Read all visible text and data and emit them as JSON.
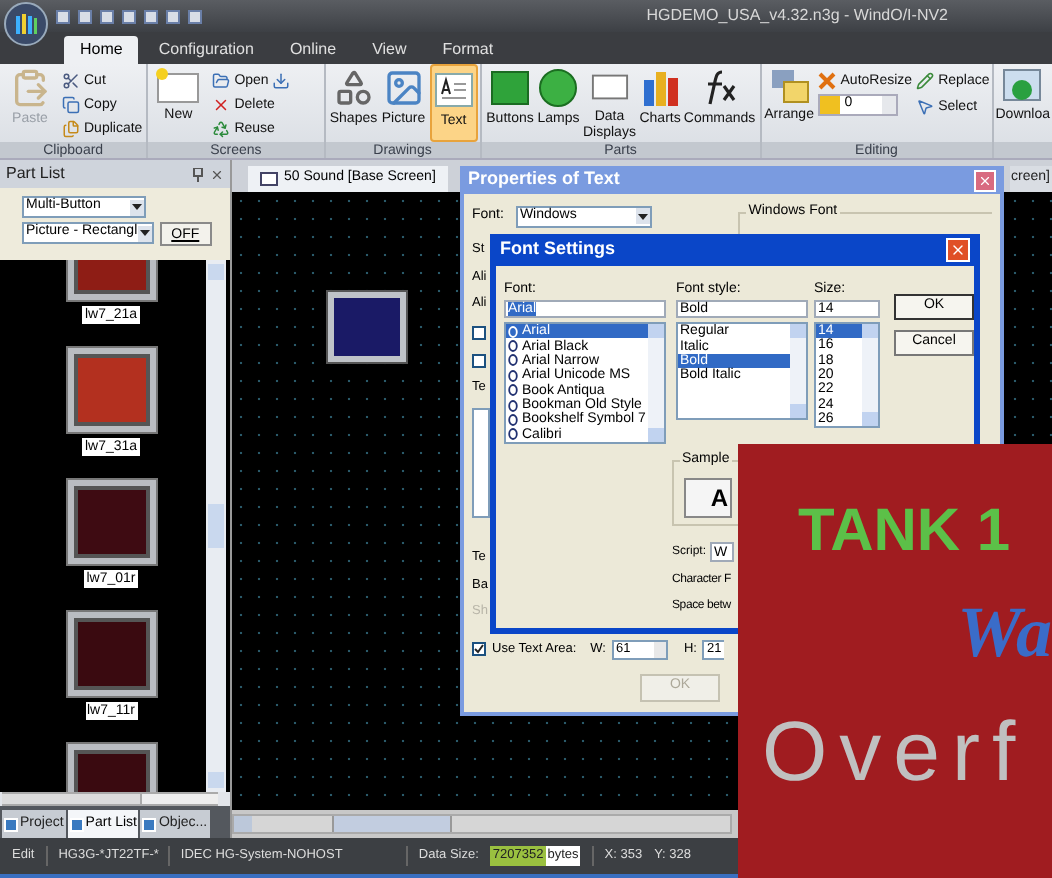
{
  "window": {
    "title": "HGDEMO_USA_v4.32.n3g - WindO/I-NV2"
  },
  "ribbon_tabs": [
    {
      "label": "Home",
      "selected": true
    },
    {
      "label": "Configuration",
      "selected": false
    },
    {
      "label": "Online",
      "selected": false
    },
    {
      "label": "View",
      "selected": false
    },
    {
      "label": "Format",
      "selected": false
    }
  ],
  "ribbon": {
    "clipboard": {
      "label": "Clipboard",
      "items": [
        {
          "label": "Paste",
          "disabled": true
        },
        {
          "label": "Cut",
          "disabled": false
        },
        {
          "label": "Copy",
          "disabled": false
        },
        {
          "label": "Duplicate",
          "disabled": false
        }
      ]
    },
    "screens": {
      "label": "Screens",
      "new": "New",
      "open": "Open",
      "delete": "Delete",
      "reuse": "Reuse"
    },
    "drawings": {
      "label": "Drawings",
      "items": [
        {
          "label": "Shapes",
          "selected": false
        },
        {
          "label": "Picture",
          "selected": false
        },
        {
          "label": "Text",
          "selected": true
        }
      ]
    },
    "parts": {
      "label": "Parts",
      "items": [
        "Buttons",
        "Lamps",
        "Data Displays",
        "Charts",
        "Commands"
      ]
    },
    "editing": {
      "label": "Editing",
      "arrange": "Arrange",
      "autoresize": "AutoResize",
      "spin_value": "0",
      "replace": "Replace",
      "select": "Select"
    },
    "download": {
      "label": "Downloa"
    }
  },
  "part_list": {
    "title": "Part List",
    "type_select": "Multi-Button",
    "style_select": "Picture - Rectangl",
    "state_button": "OFF",
    "parts": [
      {
        "label": "lw7_21a",
        "color": "#8e1d15"
      },
      {
        "label": "lw7_31a",
        "color": "#b3301f"
      },
      {
        "label": "lw7_01r",
        "color": "#3e0b12"
      },
      {
        "label": "lw7_11r",
        "color": "#3a0a10"
      },
      {
        "color": "#3a0a10"
      }
    ],
    "bottom_tabs": [
      {
        "label": "Project",
        "selected": false
      },
      {
        "label": "Part List",
        "selected": true
      },
      {
        "label": "Objec...",
        "selected": false
      }
    ]
  },
  "editor": {
    "tabs": [
      {
        "label": "50 Sound [Base Screen]",
        "selected": true
      },
      {
        "label": "creen]",
        "selected": false
      }
    ]
  },
  "properties_dialog": {
    "title": "Properties of Text",
    "font_label": "Font:",
    "font_value": "Windows",
    "windows_font_group": "Windows Font",
    "side_labels": [
      "St",
      "Ali",
      "Ali"
    ],
    "checkboxes": [
      {
        "checked": false
      },
      {
        "checked": false
      }
    ],
    "lower_labels": [
      {
        "label": "Te",
        "disabled": false
      },
      {
        "label": "Ba",
        "disabled": false
      },
      {
        "label": "Sh",
        "disabled": true
      }
    ],
    "text_area_label": "Te",
    "use_text_area": {
      "label": "Use Text Area:",
      "checked": true
    },
    "w_label": "W:",
    "w_value": "61",
    "h_label": "H:",
    "h_value": "21",
    "ok": {
      "label": "OK",
      "disabled": true
    }
  },
  "font_dialog": {
    "title": "Font Settings",
    "font_label": "Font:",
    "font_value": "Arial",
    "fonts": [
      {
        "label": "Arial",
        "selected": true
      },
      {
        "label": "Arial Black",
        "selected": false
      },
      {
        "label": "Arial Narrow",
        "selected": false
      },
      {
        "label": "Arial Unicode MS",
        "selected": false
      },
      {
        "label": "Book Antiqua",
        "selected": false
      },
      {
        "label": "Bookman Old Style",
        "selected": false
      },
      {
        "label": "Bookshelf Symbol 7",
        "selected": false
      },
      {
        "label": "Calibri",
        "selected": false
      }
    ],
    "style_label": "Font style:",
    "style_value": "Bold",
    "styles": [
      {
        "label": "Regular",
        "selected": false
      },
      {
        "label": "Italic",
        "selected": false
      },
      {
        "label": "Bold",
        "selected": true
      },
      {
        "label": "Bold Italic",
        "selected": false
      }
    ],
    "size_label": "Size:",
    "size_value": "14",
    "sizes": [
      {
        "label": "14",
        "selected": true
      },
      {
        "label": "16",
        "selected": false
      },
      {
        "label": "18",
        "selected": false
      },
      {
        "label": "20",
        "selected": false
      },
      {
        "label": "22",
        "selected": false
      },
      {
        "label": "24",
        "selected": false
      },
      {
        "label": "26",
        "selected": false
      }
    ],
    "ok": "OK",
    "cancel": "Cancel",
    "sample_group": "Sample",
    "sample_text": "A",
    "script_label": "Script:",
    "script_value": "W",
    "character_label": "Character F",
    "space_label": "Space betw"
  },
  "overlay": {
    "title": "TANK 1",
    "subtitle": "Wa",
    "caption": "Overf"
  },
  "status_bar": {
    "mode": "Edit",
    "model": "HG3G-*JT22TF-*",
    "system": "IDEC HG-System-NOHOST",
    "data_size_label": "Data Size:",
    "data_size_value": "7207352",
    "data_size_unit": "bytes",
    "x": "X: 353",
    "y": "Y: 328"
  }
}
